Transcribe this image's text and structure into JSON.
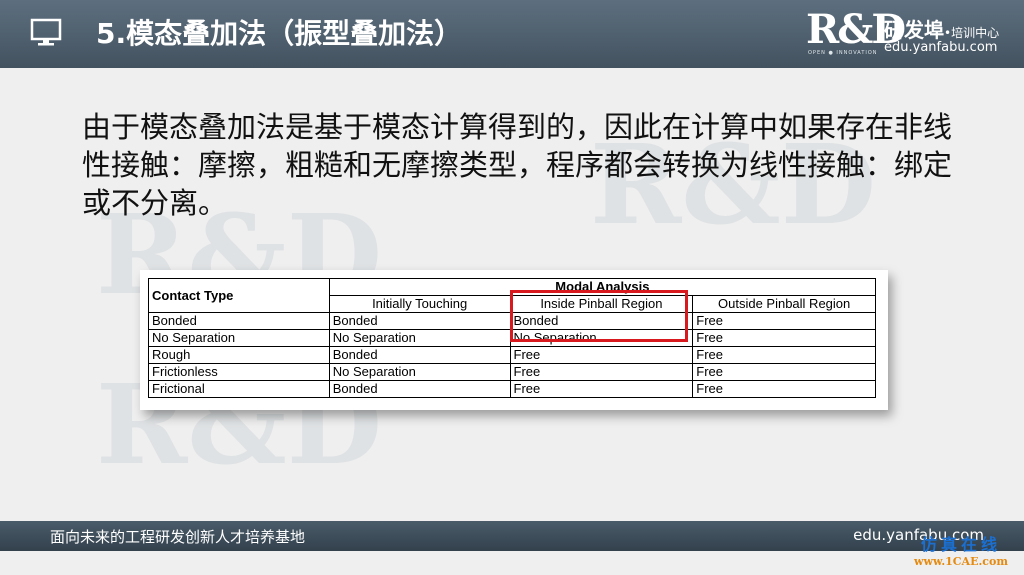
{
  "header": {
    "title": "5.模态叠加法（振型叠加法）",
    "logo": {
      "mark": "R&D",
      "tagline": "OPEN ● INNOVATION",
      "name": "研发埠",
      "name_suffix": "•培训中心",
      "url": "edu.yanfabu.com"
    }
  },
  "body": {
    "paragraph": "由于模态叠加法是基于模态计算得到的，因此在计算中如果存在非线性接触：摩擦，粗糙和无摩擦类型，程序都会转换为线性接触：绑定或不分离。"
  },
  "table": {
    "col_header": "Contact Type",
    "group_header": "Modal Analysis",
    "sub_headers": [
      "Initially Touching",
      "Inside Pinball Region",
      "Outside Pinball Region"
    ],
    "rows": [
      [
        "Bonded",
        "Bonded",
        "Bonded",
        "Free"
      ],
      [
        "No Separation",
        "No Separation",
        "No Separation",
        "Free"
      ],
      [
        "Rough",
        "Bonded",
        "Free",
        "Free"
      ],
      [
        "Frictionless",
        "No Separation",
        "Free",
        "Free"
      ],
      [
        "Frictional",
        "Bonded",
        "Free",
        "Free"
      ]
    ],
    "highlight_color": "#d8191d"
  },
  "footer": {
    "left": "面向未来的工程研发创新人才培养基地",
    "right": "edu.yanfabu.com"
  },
  "stamp": {
    "cn": "仿真在线",
    "en": "www.1CAE.com"
  },
  "colors": {
    "header_bg": "#4f6070",
    "page_bg": "#efefef"
  },
  "icons": {
    "header": "monitor-icon"
  }
}
